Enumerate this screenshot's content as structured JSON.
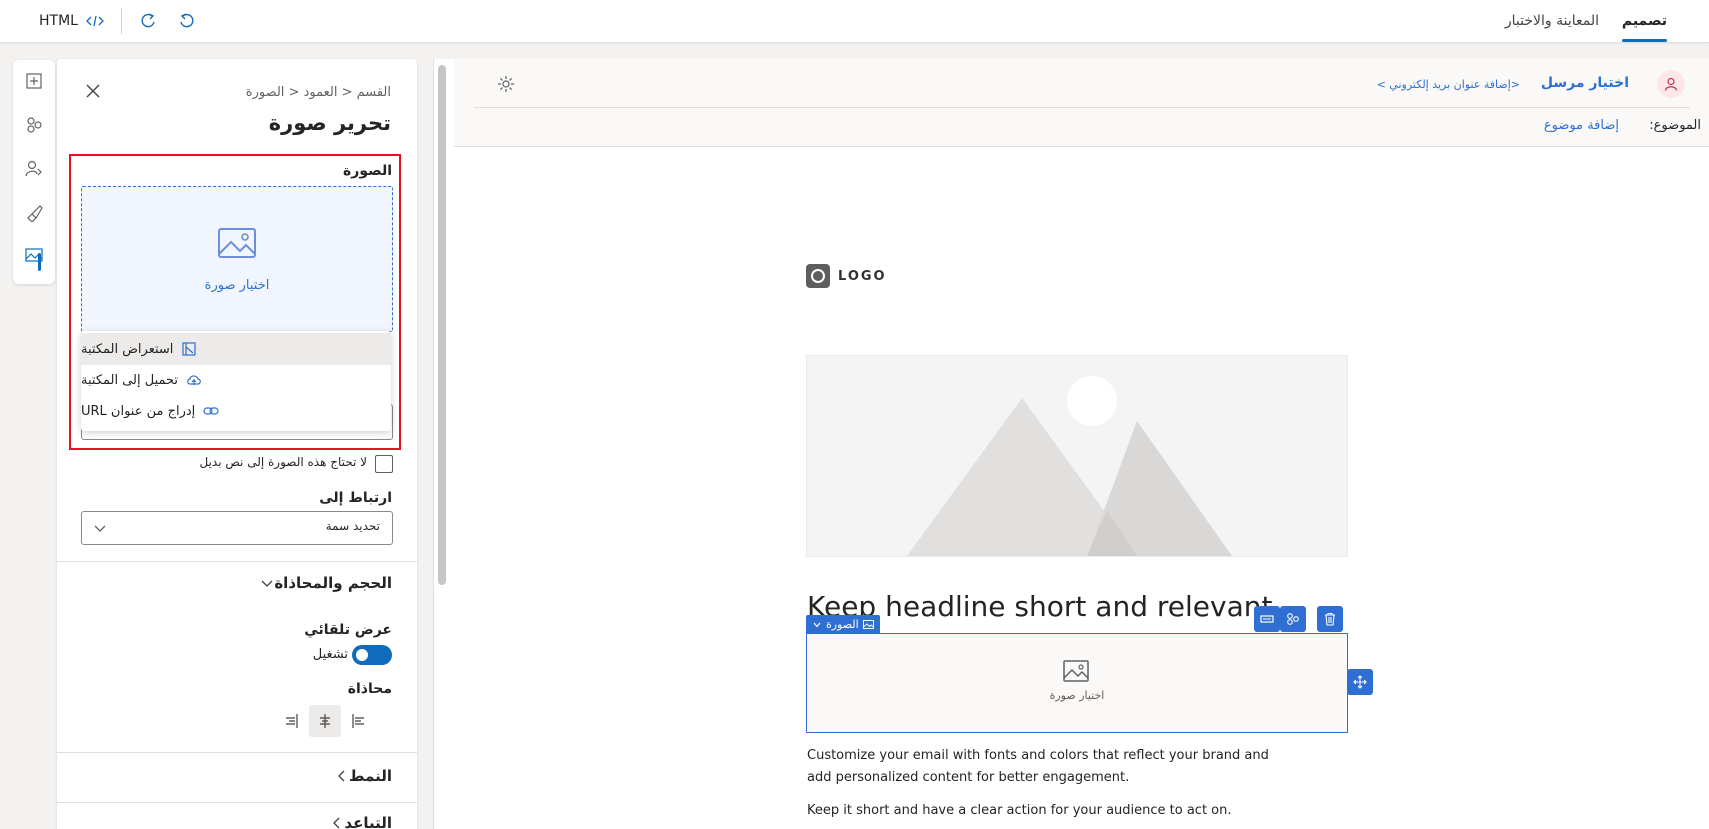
{
  "topbar": {
    "tab_design": "تصميم",
    "tab_preview": "المعاينة والاختبار",
    "html_label": "HTML"
  },
  "panel": {
    "breadcrumb": "القسم < العمود < الصورة",
    "title": "تحرير صورة",
    "image_label": "الصورة",
    "choose_image": "اختيار صورة",
    "menu": [
      {
        "label": "استعراض المكتبة",
        "icon": "library-icon"
      },
      {
        "label": "تحميل إلى المكتبة",
        "icon": "cloud-upload-icon"
      },
      {
        "label": "إدراج من عنوان URL",
        "icon": "link-icon"
      }
    ],
    "alt_checkbox_label": "لا تحتاج هذه الصورة إلى نص بديل",
    "link_label": "ارتباط إلى",
    "link_select_value": "تحديد سمة",
    "size_section": "الحجم والمحاذاة",
    "auto_width_label": "عرض تلقائي",
    "toggle_state": "تشغيل",
    "alignment_label": "محاذاة",
    "style_section": "النمط",
    "spacing_section": "التباعد"
  },
  "canvas": {
    "sender_label": "اختيار مرسل",
    "sender_address": "<إضافة عنوان بريد إلكتروني >",
    "subject_label": "الموضوع:",
    "subject_link": "إضافة موضوع",
    "logo_text": "LOGO",
    "headline": "Keep headline short and relevant",
    "image_tag": "الصورة",
    "image_placeholder": "اختيار صورة",
    "paragraph1": "Customize your email with fonts and colors that reflect your brand and add personalized content for better engagement.",
    "paragraph2": "Keep it short and have a clear action for your audience to act on."
  },
  "colors": {
    "accent": "#0f6cbd",
    "link": "#2f6fd3",
    "highlight_border": "#e81123"
  }
}
